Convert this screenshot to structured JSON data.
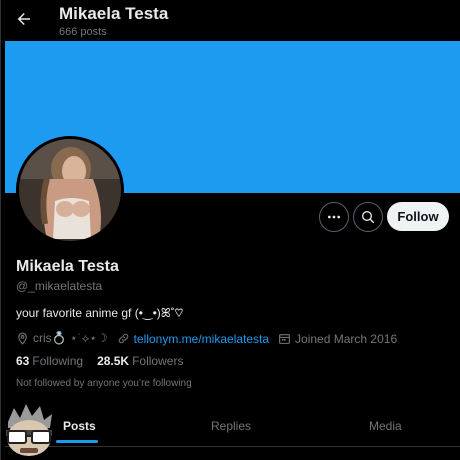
{
  "header": {
    "title": "Mikaela Testa",
    "post_count": "666 posts"
  },
  "profile": {
    "display_name": "Mikaela Testa",
    "handle": "@_mikaelatesta",
    "bio": "your favorite anime gf (•‿•)ꕤ˚♡",
    "location": "cris💍 ⋆˙⟡⋆☽",
    "website": "tellonym.me/mikaelatesta",
    "joined": "Joined March 2016",
    "following_count": "63",
    "following_label": "Following",
    "followers_count": "28.5K",
    "followers_label": "Followers",
    "not_followed_text": "Not followed by anyone you’re following"
  },
  "actions": {
    "follow_label": "Follow"
  },
  "tabs": [
    {
      "label": "Posts",
      "active": true
    },
    {
      "label": "Replies",
      "active": false
    },
    {
      "label": "Media",
      "active": false
    }
  ],
  "colors": {
    "banner": "#1d9bf0",
    "accent": "#1d9bf0",
    "background": "#000000",
    "primary_text": "#e7e9ea",
    "secondary_text": "#71767b"
  },
  "icons": [
    "back-arrow-icon",
    "more-icon",
    "search-icon",
    "location-icon",
    "link-icon",
    "calendar-icon"
  ]
}
